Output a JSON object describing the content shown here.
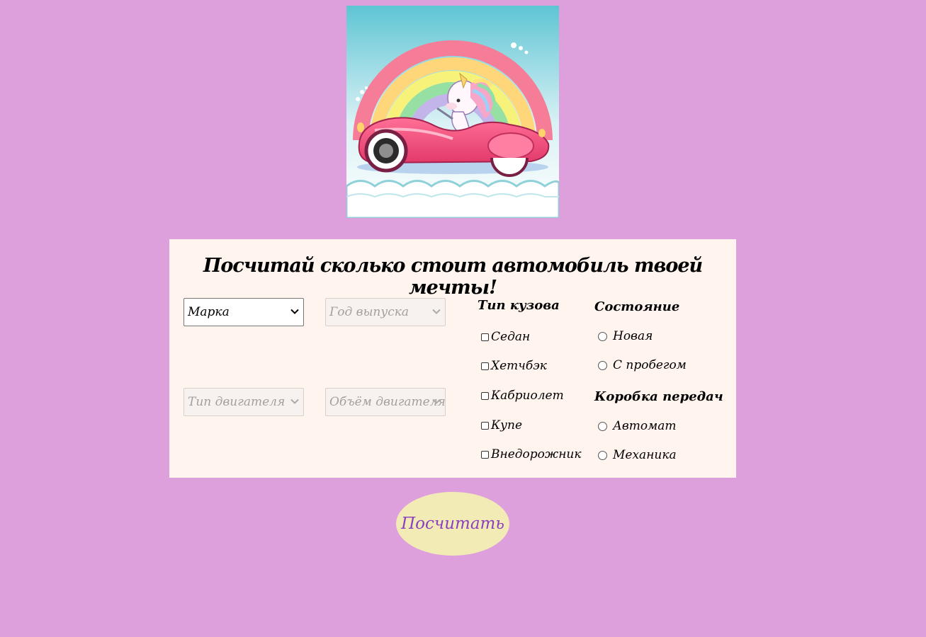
{
  "hero": {
    "image_alt": "unicorn-in-pink-car-illustration"
  },
  "form": {
    "title": "Посчитай сколько стоит автомобиль твоей мечты!",
    "selects": {
      "brand": {
        "value": "Марка",
        "enabled": true
      },
      "year": {
        "value": "Год выпуска",
        "enabled": false
      },
      "engine_type": {
        "value": "Тип двигателя",
        "enabled": false
      },
      "engine_volume": {
        "value": "Объём двигателя",
        "enabled": false
      }
    },
    "body_type": {
      "title": "Тип кузова",
      "options": [
        "Седан",
        "Хетчбэк",
        "Кабриолет",
        "Купе",
        "Внедорожник"
      ]
    },
    "condition": {
      "title": "Состояние",
      "options": [
        "Новая",
        "С пробегом"
      ]
    },
    "gearbox": {
      "title": "Коробка передач",
      "options": [
        "Автомат",
        "Механика"
      ]
    }
  },
  "calculate_button": {
    "label": "Посчитать"
  },
  "colors": {
    "page_background": "#dda0dd",
    "panel_background": "#fff4ee",
    "button_background": "#f3ebb5",
    "button_text": "#8a3fc0"
  }
}
